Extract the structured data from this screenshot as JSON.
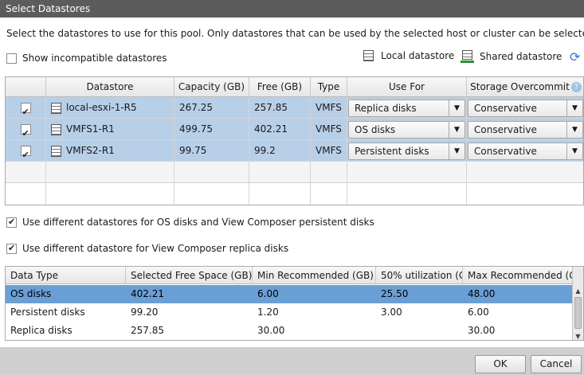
{
  "window": {
    "title": "Select Datastores"
  },
  "intro_text": "Select the datastores to use for this pool. Only datastores that can be used by the selected host or cluster can be selected.",
  "show_incompatible": {
    "label": "Show incompatible datastores",
    "checked": false
  },
  "legend": {
    "local": "Local datastore",
    "shared": "Shared datastore"
  },
  "datastore_table": {
    "headers": {
      "datastore": "Datastore",
      "capacity": "Capacity (GB)",
      "free": "Free (GB)",
      "type": "Type",
      "use_for": "Use For",
      "overcommit": "Storage Overcommit"
    },
    "rows": [
      {
        "checked": true,
        "name": "local-esxi-1-R5",
        "capacity": "267.25",
        "free": "257.85",
        "type": "VMFS",
        "use_for": "Replica disks",
        "overcommit": "Conservative"
      },
      {
        "checked": true,
        "name": "VMFS1-R1",
        "capacity": "499.75",
        "free": "402.21",
        "type": "VMFS",
        "use_for": "OS disks",
        "overcommit": "Conservative"
      },
      {
        "checked": true,
        "name": "VMFS2-R1",
        "capacity": "99.75",
        "free": "99.2",
        "type": "VMFS",
        "use_for": "Persistent disks",
        "overcommit": "Conservative"
      }
    ]
  },
  "option_os_persistent": {
    "label": "Use different datastores for OS disks and View Composer persistent disks",
    "checked": true
  },
  "option_replica": {
    "label": "Use different datastore for View Composer replica disks",
    "checked": true
  },
  "datatype_table": {
    "headers": {
      "data_type": "Data Type",
      "selected_free": "Selected Free Space (GB)",
      "min_rec": "Min Recommended (GB)",
      "util50": "50% utilization (G",
      "max_rec": "Max Recommended (G"
    },
    "rows": [
      {
        "data_type": "OS disks",
        "selected_free": "402.21",
        "min_rec": "6.00",
        "util50": "25.50",
        "max_rec": "48.00"
      },
      {
        "data_type": "Persistent disks",
        "selected_free": "99.20",
        "min_rec": "1.20",
        "util50": "3.00",
        "max_rec": "6.00"
      },
      {
        "data_type": "Replica disks",
        "selected_free": "257.85",
        "min_rec": "30.00",
        "util50": "",
        "max_rec": "30.00"
      }
    ]
  },
  "buttons": {
    "ok": "OK",
    "cancel": "Cancel"
  }
}
